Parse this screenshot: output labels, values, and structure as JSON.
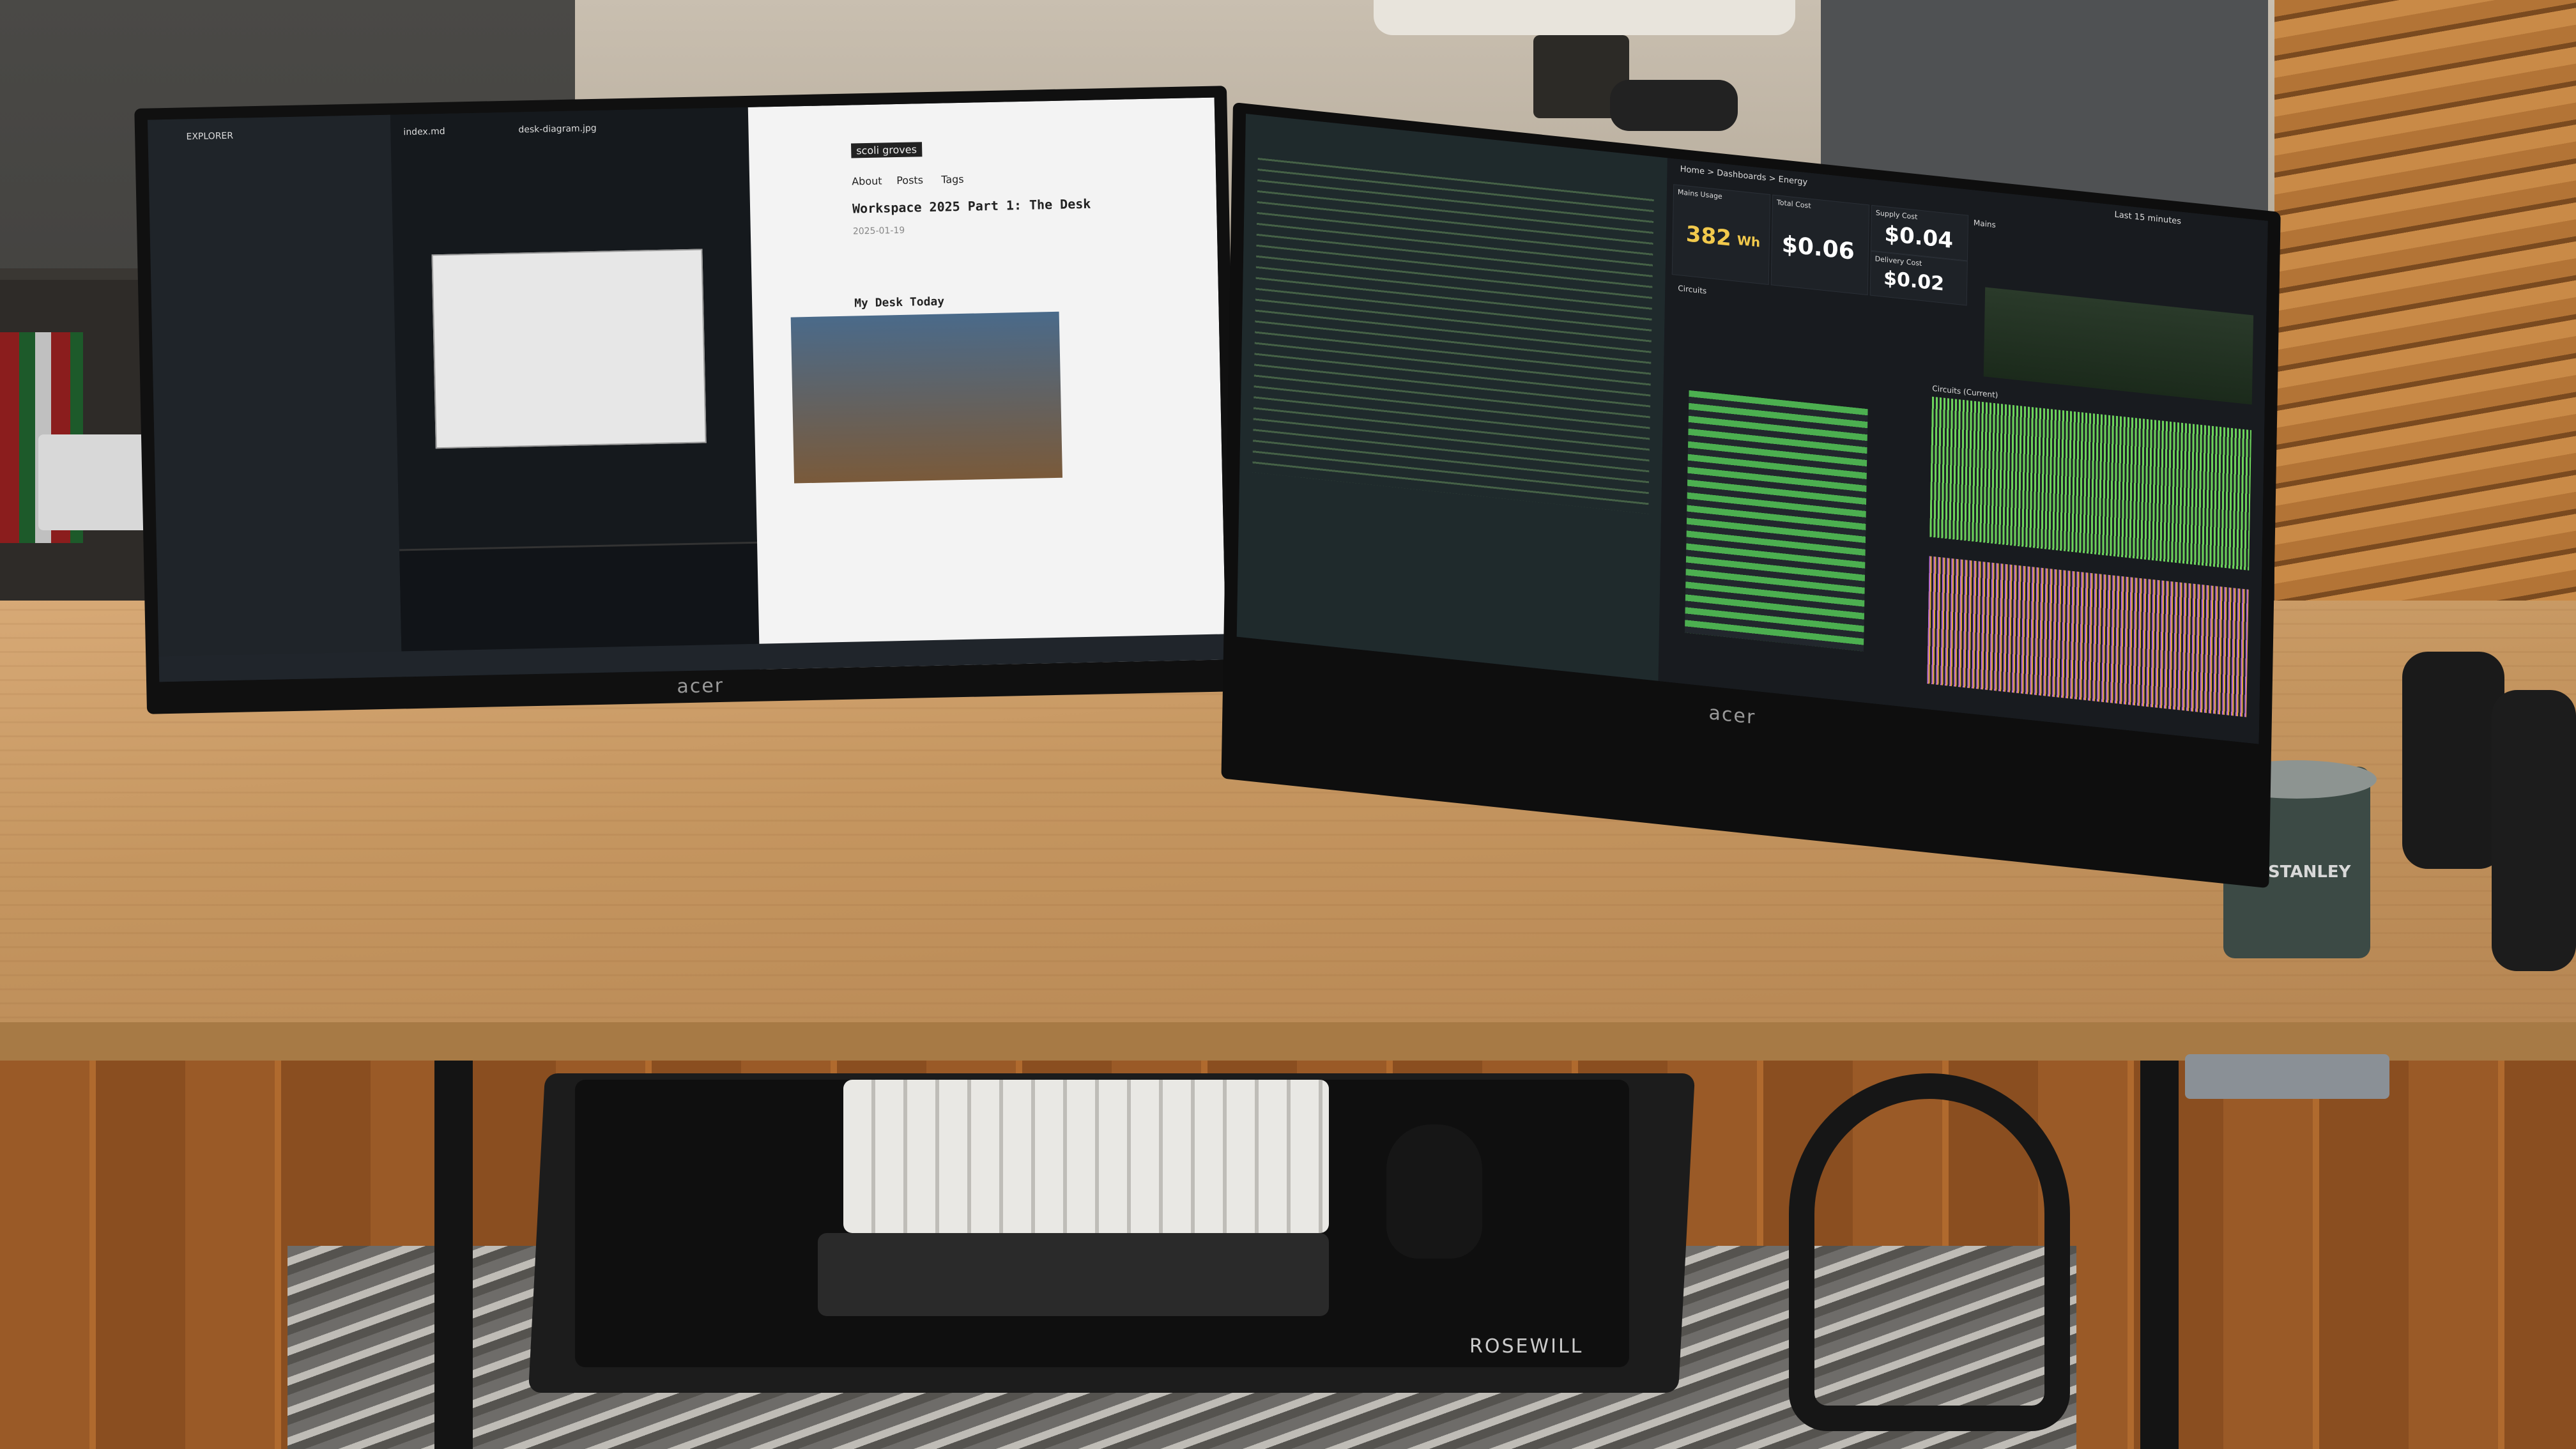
{
  "left_monitor": {
    "brand": "acer",
    "editor": {
      "explorer_title": "EXPLORER",
      "tabs": [
        "index.md",
        "desk-diagram.jpg"
      ]
    },
    "blog": {
      "site_title": "scoli groves",
      "nav": [
        "About",
        "Posts",
        "Tags"
      ],
      "post_title": "Workspace 2025 Part 1: The Desk",
      "date": "2025-01-19",
      "section_heading": "My Desk Today"
    }
  },
  "right_monitor": {
    "brand": "acer",
    "dashboard": {
      "breadcrumb": "Home > Dashboards > Energy",
      "time_range": "Last 15 minutes",
      "stats": [
        {
          "label": "Mains Usage",
          "value": "382",
          "unit": "Wh",
          "color": "#f2c94c"
        },
        {
          "label": "Total Cost",
          "value": "$0.06",
          "unit": "",
          "color": "#ffffff"
        },
        {
          "label": "Supply Cost",
          "value": "$0.04",
          "unit": "",
          "color": "#ffffff"
        },
        {
          "label": "Delivery Cost",
          "value": "$0.02",
          "unit": "",
          "color": "#ffffff"
        }
      ],
      "panels": [
        "Mains",
        "Circuits",
        "Circuits (Current)"
      ]
    }
  },
  "desk_items": {
    "mug_brand": "STANLEY",
    "mat_brand": "ROSEWILL"
  },
  "colors": {
    "desk_wood": "#c59660",
    "screen_bg": "#1b2128",
    "graph_green": "#6cd35b"
  }
}
